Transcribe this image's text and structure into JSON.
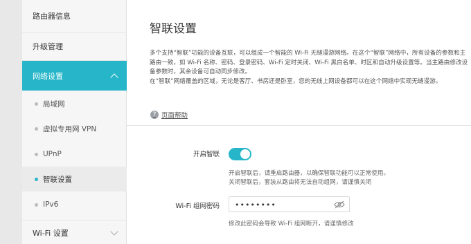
{
  "sidebar": {
    "items": [
      {
        "label": "路由器信息"
      },
      {
        "label": "升级管理"
      },
      {
        "label": "网络设置"
      }
    ],
    "subitems": [
      {
        "label": "局域网"
      },
      {
        "label": "虚拟专用网 VPN"
      },
      {
        "label": "UPnP"
      },
      {
        "label": "智联设置"
      },
      {
        "label": "IPv6"
      }
    ],
    "wifi_group": {
      "label": "Wi-Fi 设置"
    }
  },
  "main": {
    "title": "智联设置",
    "description": "多个支持“智联”功能的设备互联，可以组成一个智能的 Wi-Fi 无缝漫游网络。在这个“智联”网络中，所有设备的参数和主路由一致，如 Wi-Fi 名称、密码、登录密码、Wi-Fi 定时关闭、Wi-Fi 黑白名单、时区和自动升级设置等。当主路由修改设备参数时，其余设备可自动同步修改。\n在“智联”网络覆盖的区域，无论是客厅、书房还是卧室，您的无线上网设备都可以在这个网络中实现无缝漫游。",
    "help_icon": "?",
    "help_link": "页面帮助",
    "smart_link": {
      "label": "开启智联",
      "enabled": true,
      "hint_line1": "开启智联后，请重启路由器，以确保智联功能可以正常使用。",
      "hint_line2": "关闭智联后，套装从路由将无法自动组网，请谨慎关闭"
    },
    "wifi_password": {
      "label": "Wi-Fi 组网密码",
      "value": "••••••••",
      "hint": "修改此密码会导致 Wi-Fi 组网断开，请谨慎修改"
    }
  },
  "colors": {
    "accent": "#27b6c9"
  },
  "icons": {
    "help": "question-circle-icon",
    "password_visibility": "eye-slash-icon",
    "expanded_chevron": "chevron-up-icon",
    "collapsed_chevron": "chevron-down-icon",
    "sub_bullet": "dot-icon"
  }
}
